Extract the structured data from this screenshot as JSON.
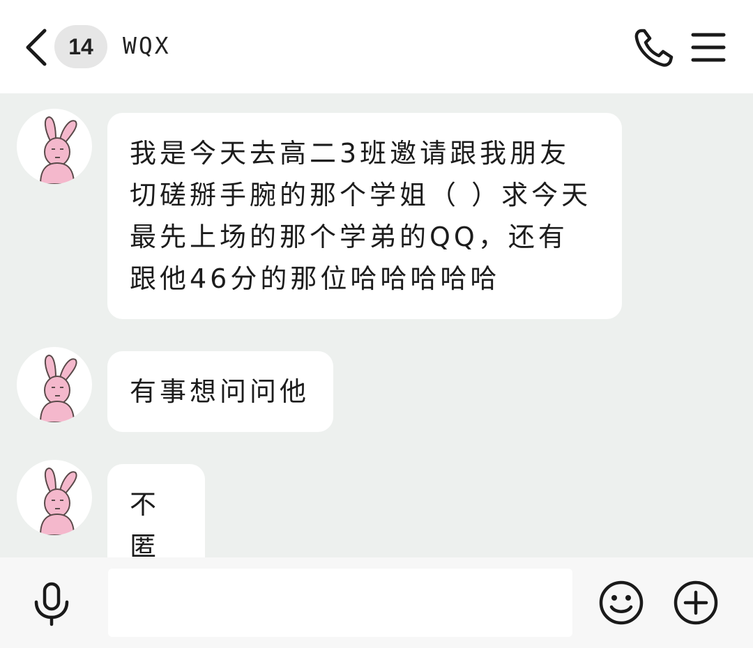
{
  "header": {
    "back_icon": "chevron-left-icon",
    "unread_count": "14",
    "contact_name": "WQX",
    "call_icon": "phone-icon",
    "menu_icon": "hamburger-menu-icon"
  },
  "messages": [
    {
      "sender_avatar": "pink-rabbit-avatar",
      "lines": [
        "我是今天去高二3班邀请跟我朋友",
        "切磋掰手腕的那个学姐（ ）求今天",
        "最先上场的那个学弟的QQ，还有",
        "跟他46分的那位哈哈哈哈哈"
      ]
    },
    {
      "sender_avatar": "pink-rabbit-avatar",
      "lines": [
        "有事想问问他"
      ]
    },
    {
      "sender_avatar": "pink-rabbit-avatar",
      "lines": [
        "不匿"
      ]
    }
  ],
  "input_bar": {
    "voice_icon": "microphone-icon",
    "input_value": "",
    "emoji_icon": "smiley-icon",
    "plus_icon": "plus-circle-icon"
  },
  "colors": {
    "chat_background": "#edf0ee",
    "bubble": "#ffffff",
    "avatar_rabbit": "#f4b8cc"
  }
}
